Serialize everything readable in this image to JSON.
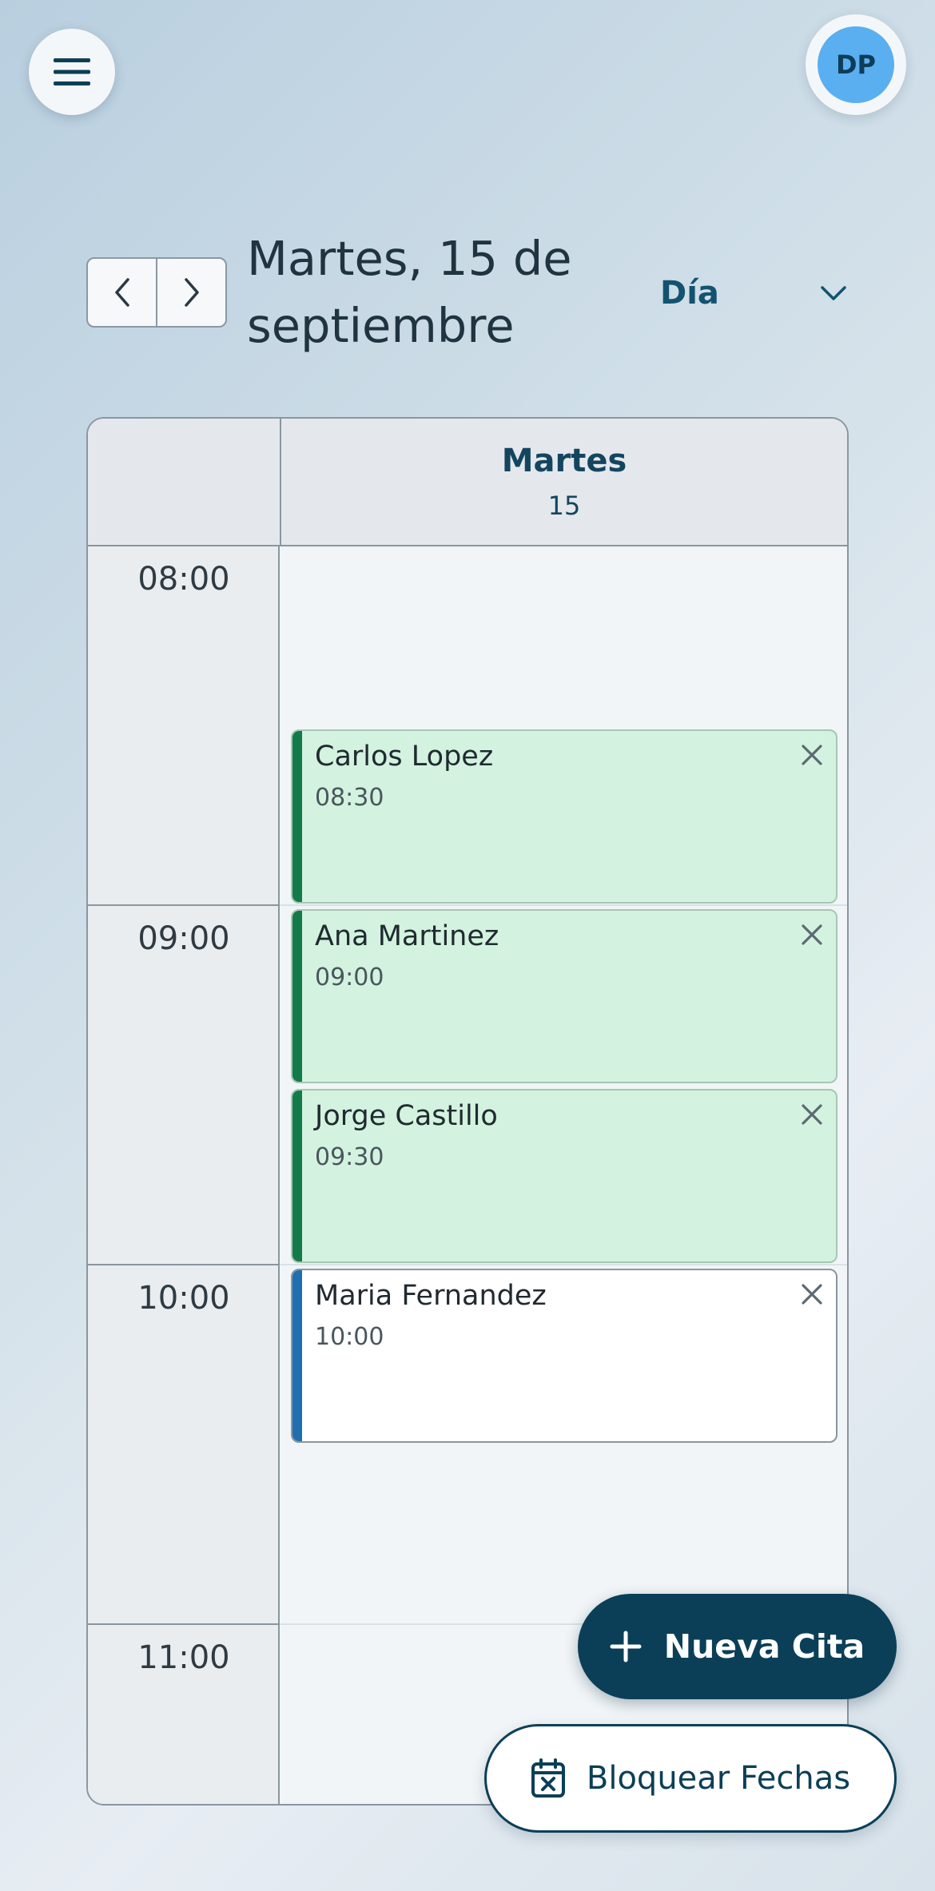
{
  "header": {
    "menu_icon": "hamburger-icon",
    "avatar_initials": "DP",
    "accent": "#0b3f57",
    "avatar_color": "#5aaff0"
  },
  "toolbar": {
    "prev_icon": "chevron-left-icon",
    "next_icon": "chevron-right-icon",
    "date_line1": "Martes, 15 de",
    "date_line2": "septiembre",
    "view_selected": "Día",
    "view_icon": "chevron-down-icon"
  },
  "calendar": {
    "day_name": "Martes",
    "day_number": "15",
    "hours": [
      "08:00",
      "09:00",
      "10:00",
      "11:00"
    ],
    "events": [
      {
        "name": "Carlos Lopez",
        "time": "08:30",
        "status_color": "#137a4a"
      },
      {
        "name": "Ana Martinez",
        "time": "09:00",
        "status_color": "#137a4a"
      },
      {
        "name": "Jorge Castillo",
        "time": "09:30",
        "status_color": "#137a4a"
      },
      {
        "name": "Maria Fernandez",
        "time": "10:00",
        "status_color": "#1f6fb0"
      }
    ]
  },
  "actions": {
    "new_label": "Nueva Cita",
    "new_icon": "plus-icon",
    "block_label": "Bloquear Fechas",
    "block_icon": "calendar-x-icon"
  }
}
